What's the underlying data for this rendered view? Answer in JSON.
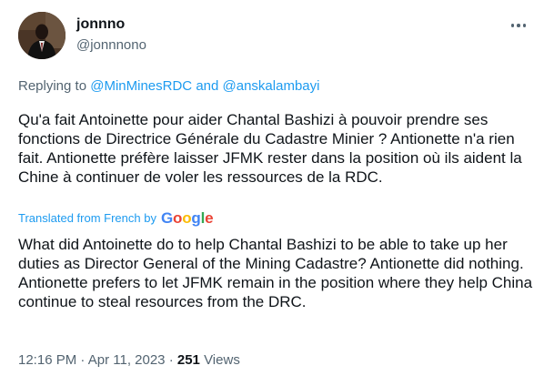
{
  "author": {
    "name": "jonnno",
    "handle": "@jonnnono"
  },
  "icons": {
    "avatar": "profile-photo",
    "more": "more-horizontal-icon"
  },
  "reply": {
    "prefix": "Replying to",
    "user1": "@MinMinesRDC",
    "joiner": "and",
    "user2": "@anskalambayi"
  },
  "tweet": {
    "original_text": "Qu'a fait Antoinette pour aider Chantal Bashizi à pouvoir prendre ses fonctions de Directrice Générale du Cadastre Minier ? Antionette n'a rien fait. Antionette préfère laisser JFMK rester dans la position où ils aident la Chine à continuer de voler les ressources de la RDC.",
    "translated_label": "Translated from French by",
    "translator_brand": "Google",
    "translated_text": "What did Antoinette do to help Chantal Bashizi to be able to take up her duties as Director General of the Mining Cadastre? Antionette did nothing. Antionette prefers to let JFMK remain in the position where they help China continue to steal resources from the DRC."
  },
  "meta": {
    "time": "12:16 PM",
    "separator": "·",
    "date": "Apr 11, 2023",
    "views_count": "251",
    "views_label": "Views"
  },
  "colors": {
    "link": "#1d9bf0",
    "secondary_text": "#536471",
    "primary_text": "#0f1419"
  }
}
